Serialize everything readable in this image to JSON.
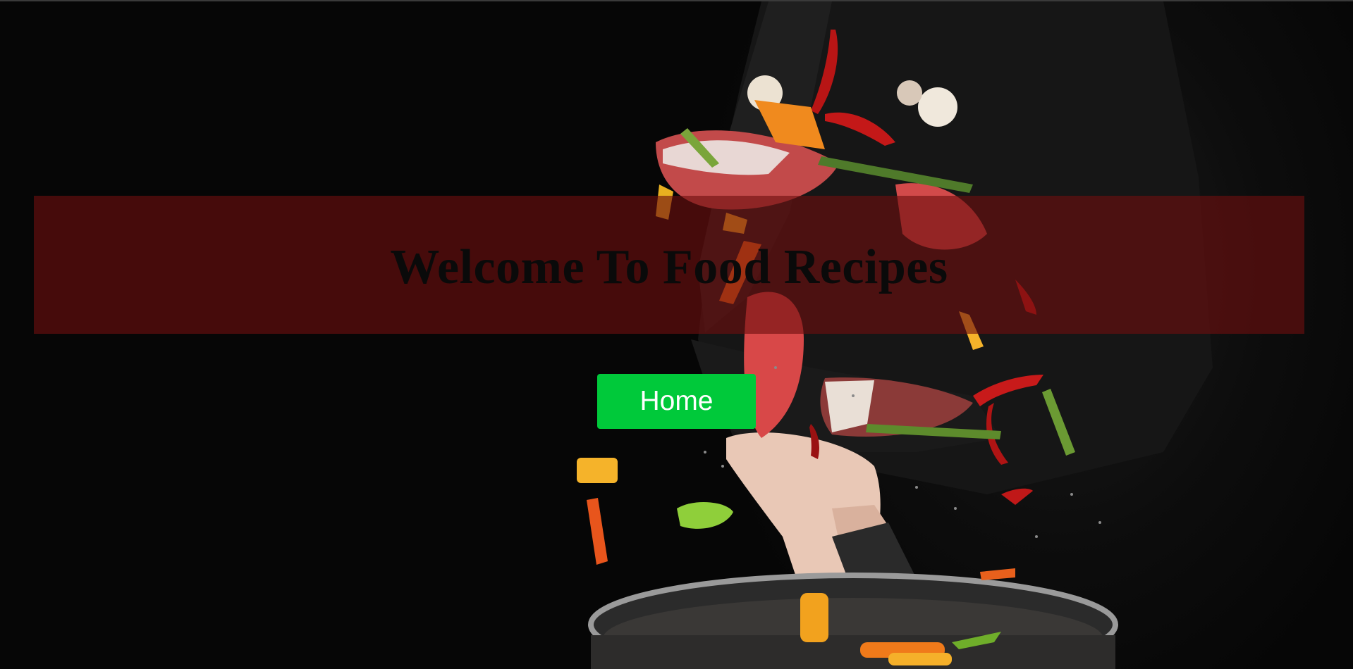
{
  "hero": {
    "title": "Welcome To Food Recipes",
    "background_image": "chef-tossing-vegetables-and-fish-in-pan"
  },
  "nav": {
    "home_label": "Home"
  },
  "colors": {
    "banner": "#6e0e0e",
    "title_text": "#0a0a0a",
    "home_button": "#00c93a",
    "home_button_text": "#ffffff",
    "page_background": "#050505"
  }
}
